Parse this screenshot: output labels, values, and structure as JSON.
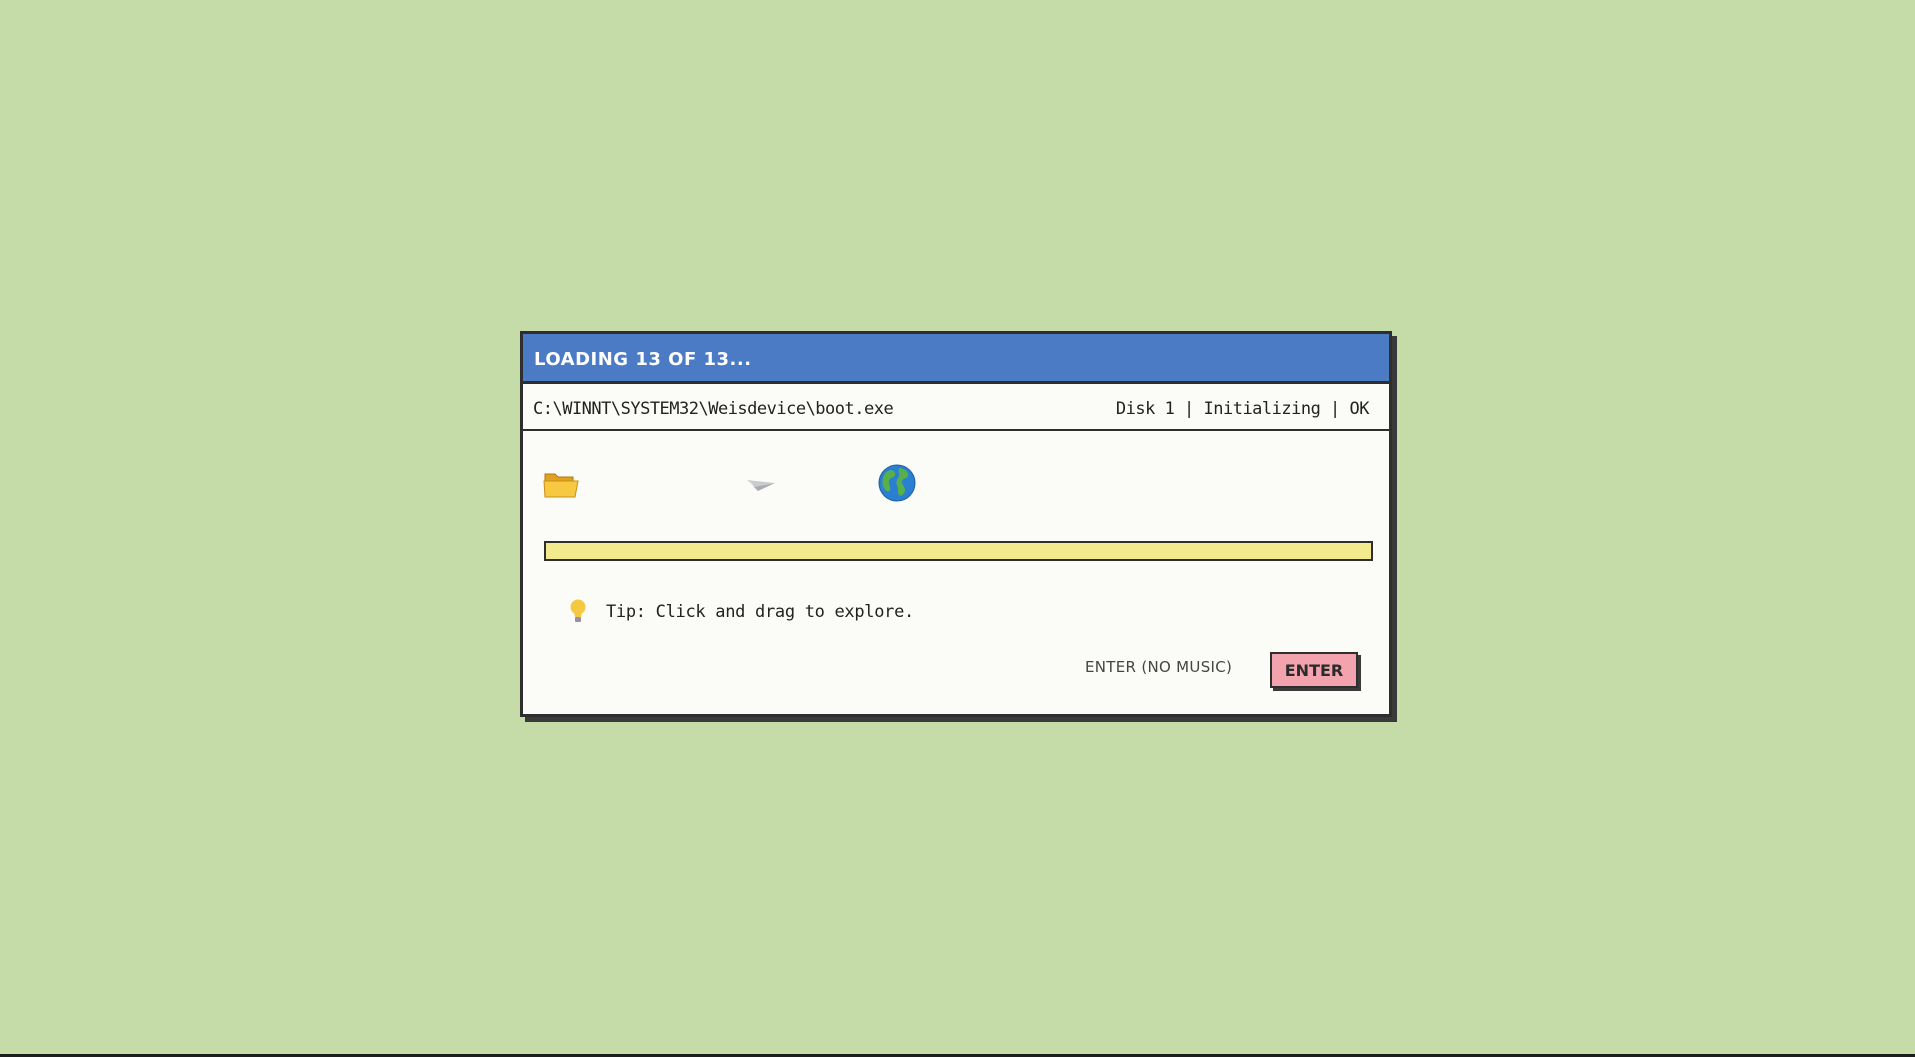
{
  "dialog": {
    "title": "LOADING 13 OF 13...",
    "path": "C:\\WINNT\\SYSTEM32\\Weisdevice\\boot.exe",
    "status": "Disk 1 | Initializing | OK",
    "progress_percent": 100,
    "tip_text": "Tip: Click and drag to explore.",
    "buttons": {
      "no_music_label": "ENTER (NO MUSIC)",
      "enter_label": "ENTER"
    },
    "icons": [
      "folder-icon",
      "paper-plane-icon",
      "globe-icon",
      "lightbulb-icon"
    ]
  },
  "colors": {
    "background": "#c5dba8",
    "titlebar": "#4a7bc4",
    "progress": "#f3ea8e",
    "enter_button": "#f2a3ad"
  }
}
